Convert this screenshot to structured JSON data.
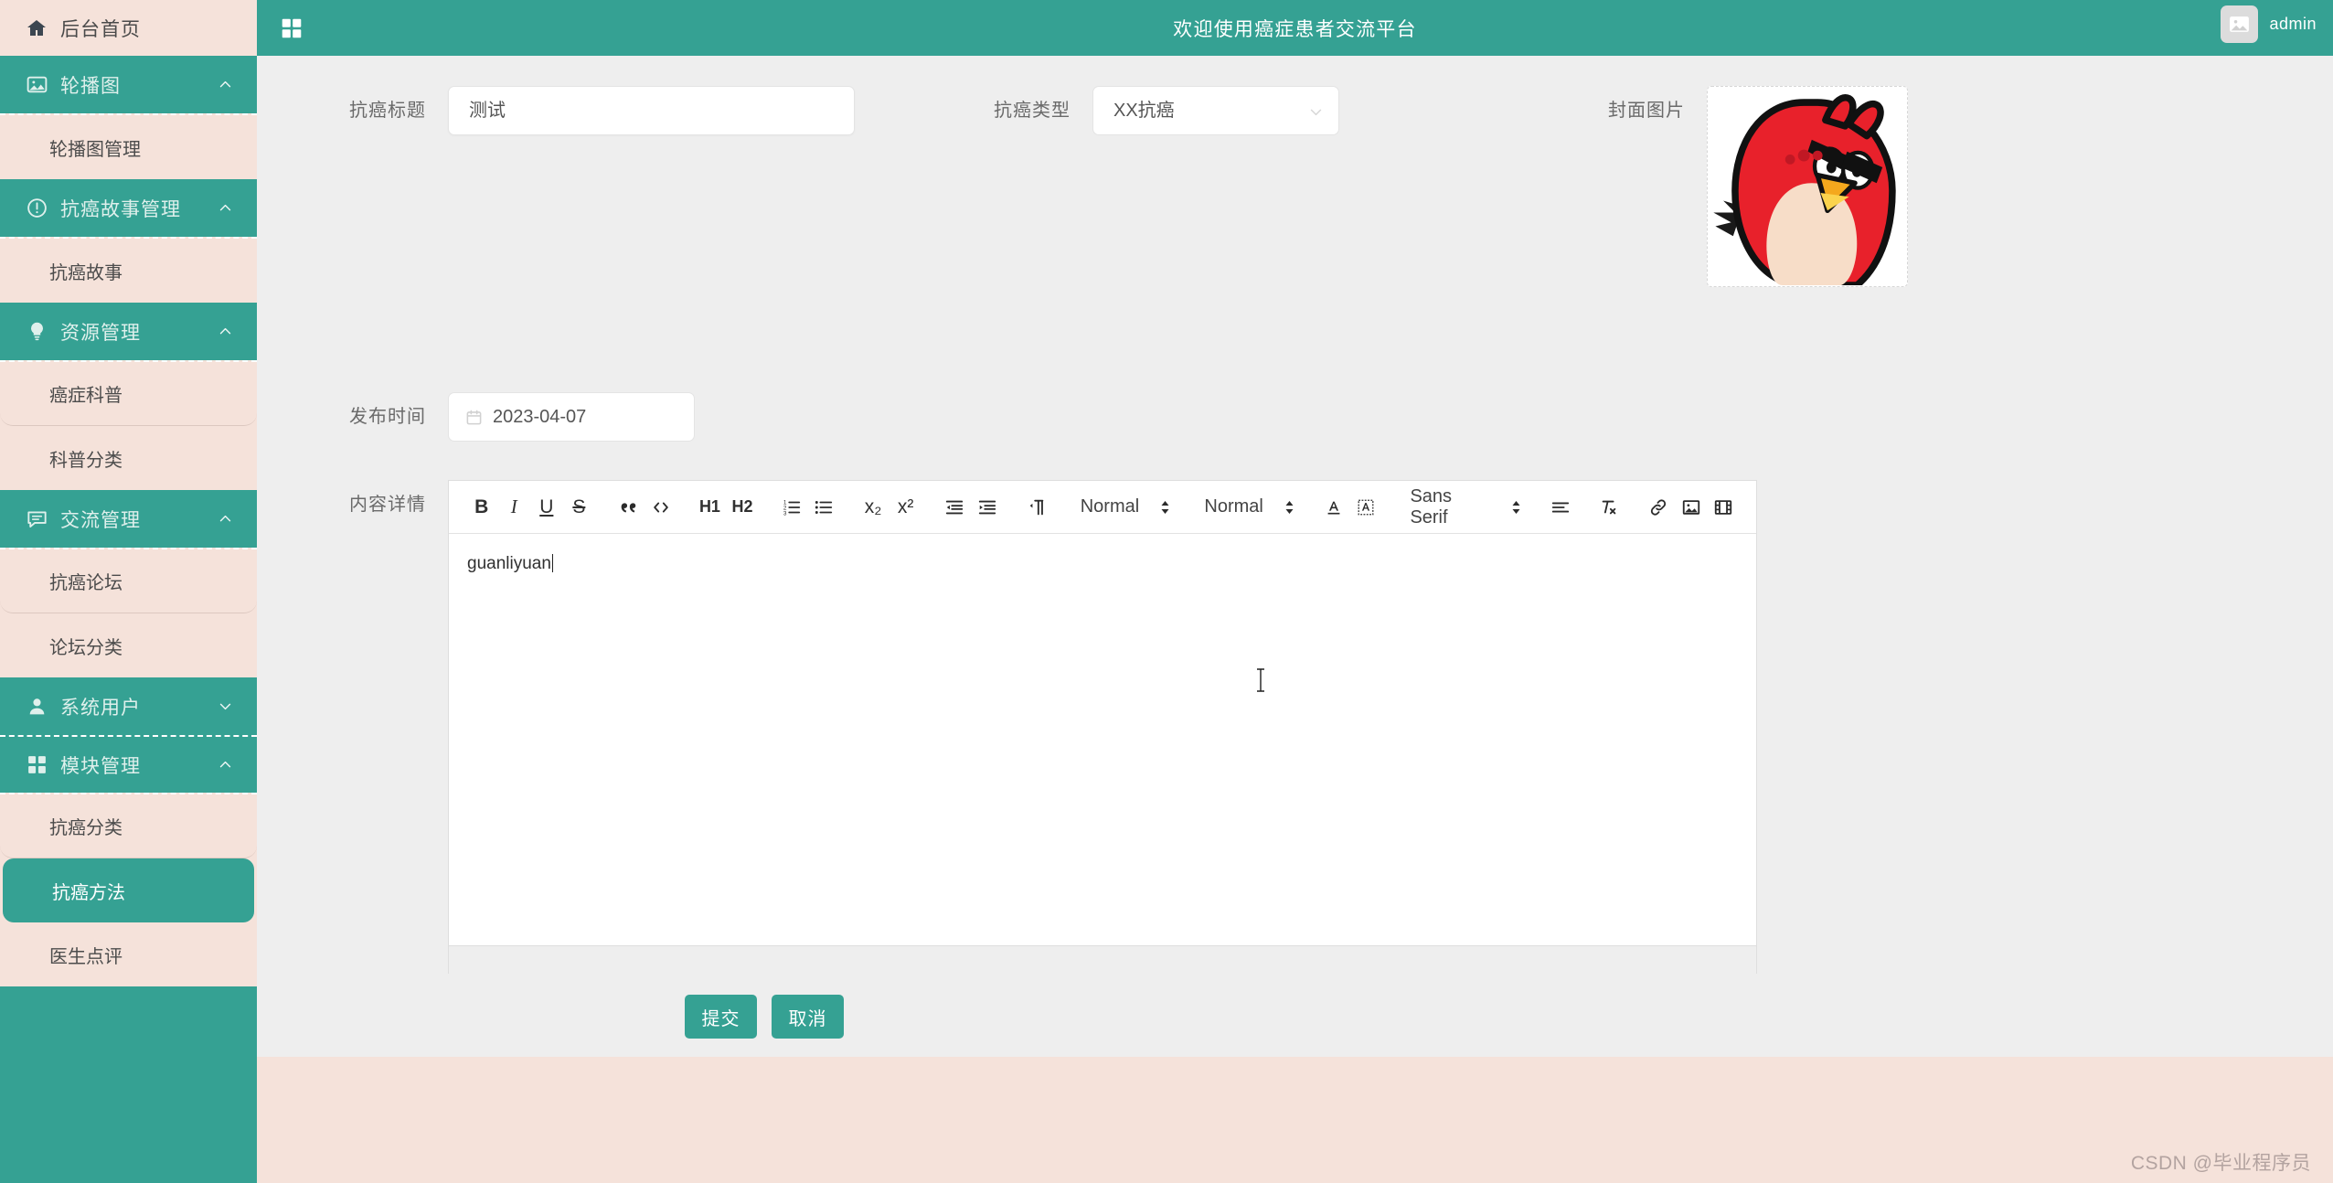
{
  "sidebar": {
    "home": {
      "label": "后台首页",
      "icon": "home-icon"
    },
    "groups": [
      {
        "label": "轮播图",
        "icon": "image-icon",
        "expanded": true,
        "chevron": "chevron-up-icon",
        "items": [
          {
            "label": "轮播图管理",
            "active": false
          }
        ]
      },
      {
        "label": "抗癌故事管理",
        "icon": "alert-circle-icon",
        "expanded": true,
        "chevron": "chevron-up-icon",
        "items": [
          {
            "label": "抗癌故事",
            "active": false
          }
        ]
      },
      {
        "label": "资源管理",
        "icon": "bulb-icon",
        "expanded": true,
        "chevron": "chevron-up-icon",
        "items": [
          {
            "label": "癌症科普",
            "active": false
          },
          {
            "label": "科普分类",
            "active": false
          }
        ]
      },
      {
        "label": "交流管理",
        "icon": "comment-icon",
        "expanded": true,
        "chevron": "chevron-up-icon",
        "items": [
          {
            "label": "抗癌论坛",
            "active": false
          },
          {
            "label": "论坛分类",
            "active": false
          }
        ]
      },
      {
        "label": "系统用户",
        "icon": "user-icon",
        "expanded": false,
        "chevron": "chevron-down-icon",
        "items": []
      },
      {
        "label": "模块管理",
        "icon": "grid-icon",
        "expanded": true,
        "chevron": "chevron-up-icon",
        "items": [
          {
            "label": "抗癌分类",
            "active": false
          },
          {
            "label": "抗癌方法",
            "active": true
          },
          {
            "label": "医生点评",
            "active": false
          }
        ]
      }
    ]
  },
  "topbar": {
    "menu_icon": "grid-icon",
    "title": "欢迎使用癌症患者交流平台",
    "avatar_icon": "image-placeholder-icon",
    "user_name": "admin"
  },
  "form": {
    "title_label": "抗癌标题",
    "title_value": "测试",
    "title_placeholder": "抗癌标题",
    "type_label": "抗癌类型",
    "type_value": "XX抗癌",
    "type_caret": "chevron-down-icon",
    "cover_label": "封面图片",
    "cover_alt": "angry-bird-red-character",
    "date_label": "发布时间",
    "date_value": "2023-04-07",
    "date_icon": "calendar-icon",
    "content_label": "内容详情",
    "content_value": "guanliyuan",
    "submit_label": "提交",
    "cancel_label": "取消"
  },
  "editor": {
    "toolbar": [
      {
        "name": "bold-icon",
        "glyph": "B",
        "type": "text"
      },
      {
        "name": "italic-icon",
        "glyph": "I",
        "type": "text"
      },
      {
        "name": "underline-icon",
        "glyph": "U",
        "type": "text"
      },
      {
        "name": "strike-icon",
        "glyph": "S",
        "type": "text"
      },
      {
        "name": "blockquote-icon",
        "glyph": "”",
        "type": "svg"
      },
      {
        "name": "code-block-icon",
        "glyph": "</>",
        "type": "svg"
      },
      {
        "name": "header-1-icon",
        "glyph": "H1",
        "type": "text"
      },
      {
        "name": "header-2-icon",
        "glyph": "H2",
        "type": "text"
      },
      {
        "name": "ordered-list-icon",
        "glyph": "",
        "type": "svg"
      },
      {
        "name": "bullet-list-icon",
        "glyph": "",
        "type": "svg"
      },
      {
        "name": "subscript-icon",
        "glyph": "x₂",
        "type": "text"
      },
      {
        "name": "superscript-icon",
        "glyph": "x²",
        "type": "text"
      },
      {
        "name": "outdent-icon",
        "glyph": "",
        "type": "svg"
      },
      {
        "name": "indent-icon",
        "glyph": "",
        "type": "svg"
      },
      {
        "name": "text-direction-icon",
        "glyph": "",
        "type": "svg"
      }
    ],
    "size_select": "Normal",
    "header_select": "Normal",
    "font_select": "Sans Serif",
    "color_icon": "font-color-icon",
    "background_icon": "background-color-icon",
    "align_icon": "align-left-icon",
    "clean_icon": "clear-format-icon",
    "link_icon": "link-icon",
    "image_icon": "image-icon",
    "video_icon": "video-icon"
  },
  "footer": {
    "watermark": "CSDN @毕业程序员"
  }
}
